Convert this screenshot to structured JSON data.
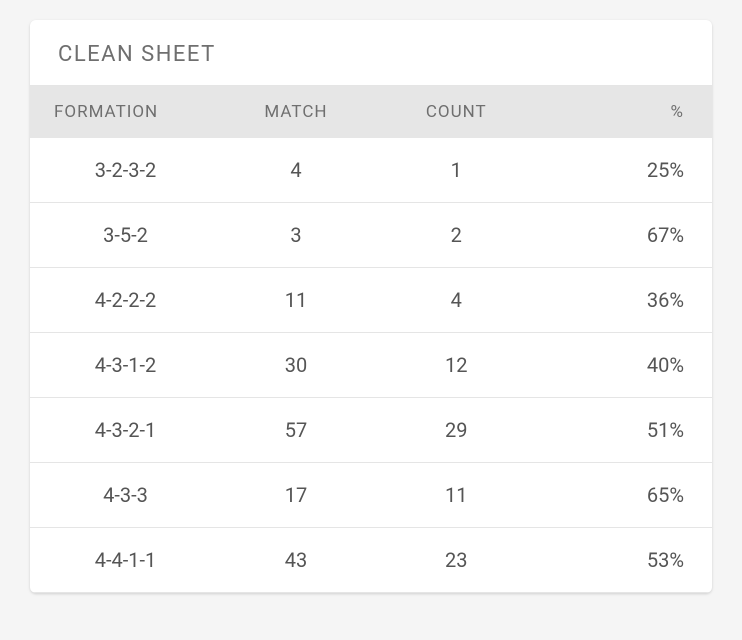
{
  "card": {
    "title": "CLEAN SHEET",
    "columns": {
      "formation": "FORMATION",
      "match": "MATCH",
      "count": "COUNT",
      "percent": "%"
    },
    "rows": [
      {
        "formation": "3-2-3-2",
        "match": "4",
        "count": "1",
        "percent": "25%"
      },
      {
        "formation": "3-5-2",
        "match": "3",
        "count": "2",
        "percent": "67%"
      },
      {
        "formation": "4-2-2-2",
        "match": "11",
        "count": "4",
        "percent": "36%"
      },
      {
        "formation": "4-3-1-2",
        "match": "30",
        "count": "12",
        "percent": "40%"
      },
      {
        "formation": "4-3-2-1",
        "match": "57",
        "count": "29",
        "percent": "51%"
      },
      {
        "formation": "4-3-3",
        "match": "17",
        "count": "11",
        "percent": "65%"
      },
      {
        "formation": "4-4-1-1",
        "match": "43",
        "count": "23",
        "percent": "53%"
      }
    ]
  }
}
